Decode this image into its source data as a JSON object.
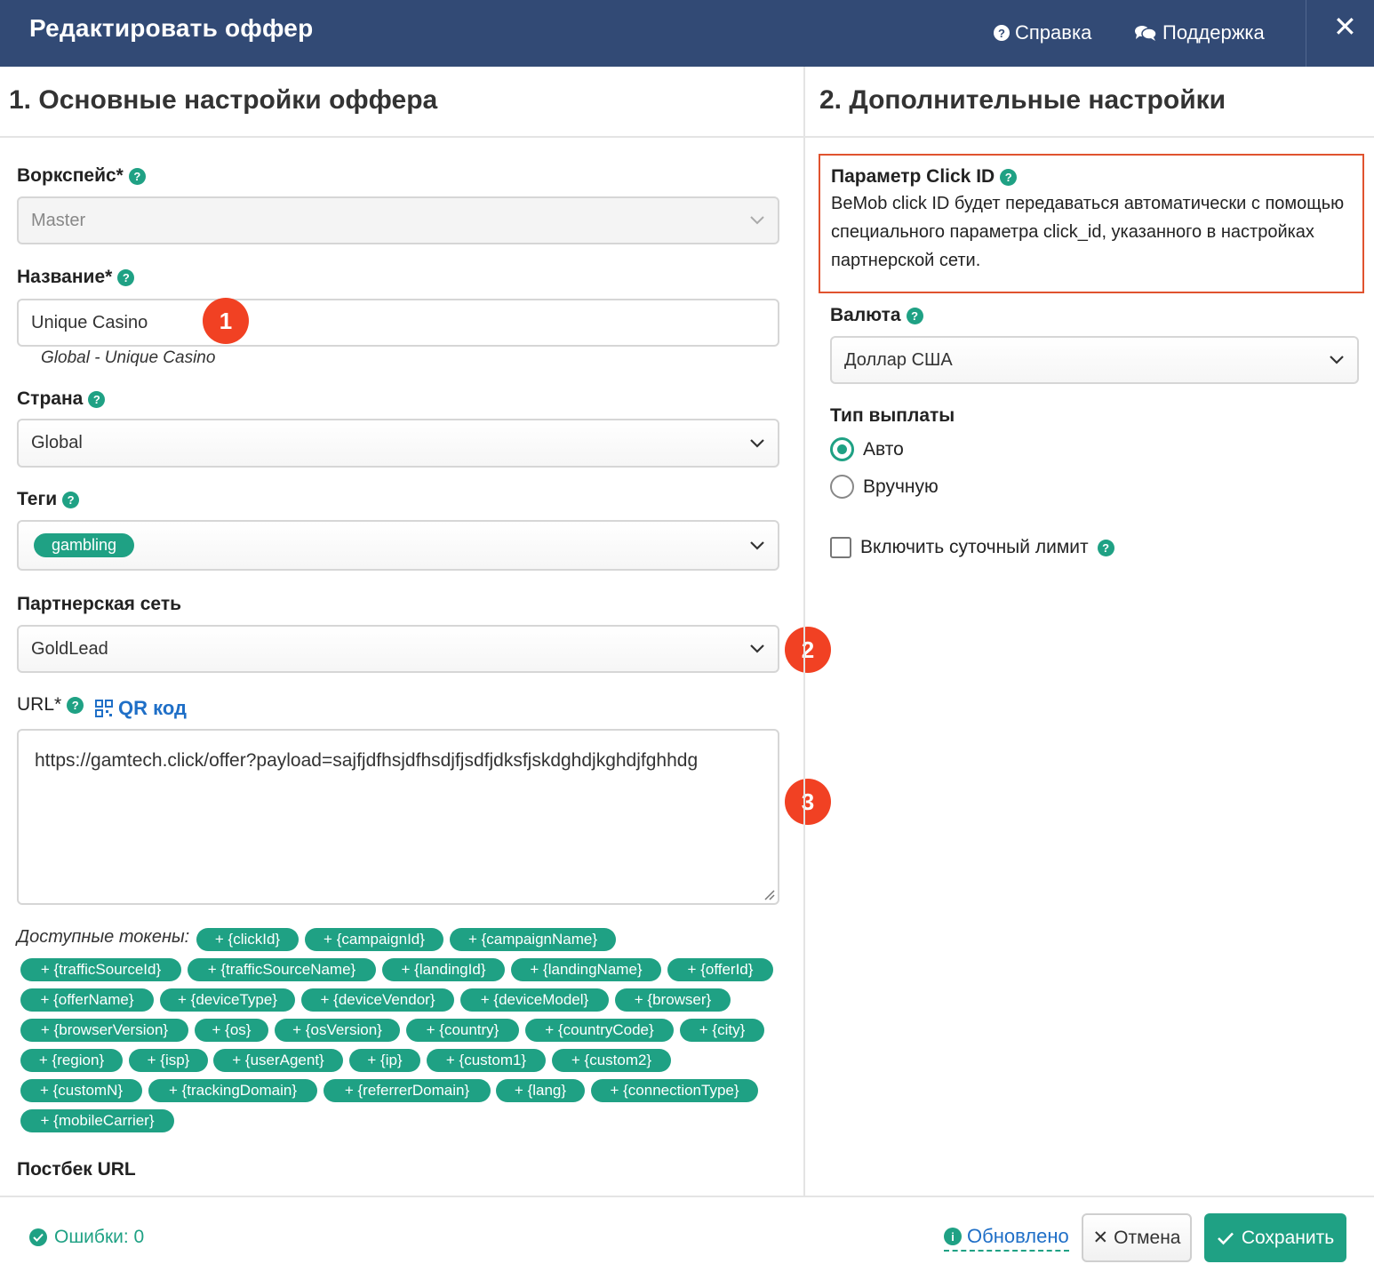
{
  "header": {
    "title": "Редактировать оффер",
    "help_label": "Справка",
    "support_label": "Поддержка",
    "close_label": "✕"
  },
  "left": {
    "section_title": "1. Основные настройки оффера",
    "workspace": {
      "label": "Воркспейс*",
      "value": "Master"
    },
    "name": {
      "label": "Название*",
      "value": "Unique Casino",
      "hint": "Global - Unique Casino"
    },
    "country": {
      "label": "Страна",
      "value": "Global"
    },
    "tags": {
      "label": "Теги",
      "chips": [
        "gambling"
      ]
    },
    "network": {
      "label": "Партнерская сеть",
      "value": "GoldLead"
    },
    "url": {
      "label": "URL*",
      "qr_label": "QR код",
      "value": "https://gamtech.click/offer?payload=sajfjdfhsjdfhsdjfjsdfjdksfjskdghdjkghdjfghhdg"
    },
    "tokens_label": "Доступные токены:",
    "tokens": [
      "+ {clickId}",
      "+ {campaignId}",
      "+ {campaignName}",
      "+ {trafficSourceId}",
      "+ {trafficSourceName}",
      "+ {landingId}",
      "+ {landingName}",
      "+ {offerId}",
      "+ {offerName}",
      "+ {deviceType}",
      "+ {deviceVendor}",
      "+ {deviceModel}",
      "+ {browser}",
      "+ {browserVersion}",
      "+ {os}",
      "+ {osVersion}",
      "+ {country}",
      "+ {countryCode}",
      "+ {city}",
      "+ {region}",
      "+ {isp}",
      "+ {userAgent}",
      "+ {ip}",
      "+ {custom1}",
      "+ {custom2}",
      "+ {customN}",
      "+ {trackingDomain}",
      "+ {referrerDomain}",
      "+ {lang}",
      "+ {connectionType}",
      "+ {mobileCarrier}"
    ],
    "postback_label": "Постбек URL"
  },
  "badges": [
    "1",
    "2",
    "3"
  ],
  "right": {
    "section_title": "2. Дополнительные настройки",
    "clickid": {
      "title": "Параметр Click ID",
      "text": "BeMob click ID будет передаваться автоматически с помощью специального параметра click_id, указанного в настройках партнерской сети."
    },
    "currency": {
      "label": "Валюта",
      "value": "Доллар США"
    },
    "payout": {
      "label": "Тип выплаты",
      "options": [
        "Авто",
        "Вручную"
      ],
      "selected": 0
    },
    "daily_limit_label": "Включить суточный лимит"
  },
  "footer": {
    "errors_label": "Ошибки: 0",
    "updated_label": "Обновлено",
    "cancel_label": "Отмена",
    "save_label": "Сохранить"
  },
  "colors": {
    "header_bg": "#324a75",
    "accent": "#1fa184",
    "badge": "#f14123",
    "link": "#1f6fc7",
    "highlight_border": "#e0532f"
  }
}
